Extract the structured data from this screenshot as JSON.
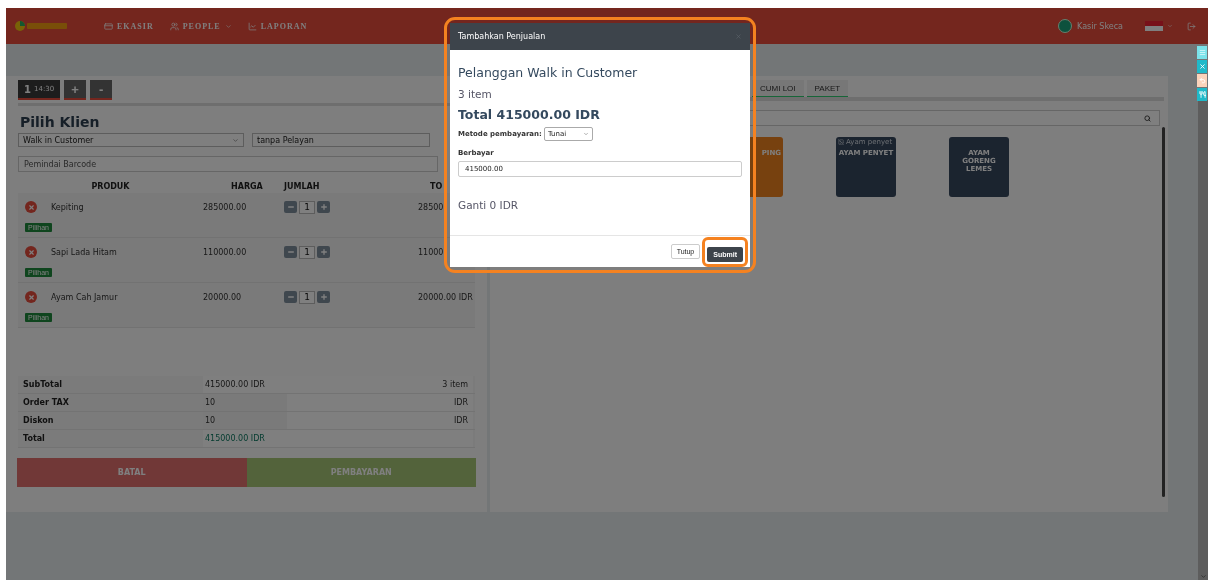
{
  "navbar": {
    "menu": [
      {
        "label": "EKASIR",
        "dropdown": false
      },
      {
        "label": "PEOPLE",
        "dropdown": true
      },
      {
        "label": "LAPORAN",
        "dropdown": false
      }
    ],
    "user": "Kasir Skeca"
  },
  "order_tab": {
    "number": "1",
    "time": "14:30",
    "selected": true
  },
  "order_actions": [
    "+",
    "-"
  ],
  "client": {
    "title": "Pilih Klien",
    "customer": "Walk in Customer",
    "waiter": "tanpa Pelayan",
    "barcode_placeholder": "Pemindai Barcode"
  },
  "cart": {
    "columns": [
      "PRODUK",
      "HARGA",
      "JUMLAH",
      "TO"
    ],
    "rows": [
      {
        "product": "Kepiting",
        "price": "285000.00",
        "qty": "1",
        "total": "28500",
        "option": "Pilihan"
      },
      {
        "product": "Sapi Lada Hitam",
        "price": "110000.00",
        "qty": "1",
        "total": "11000",
        "option": "Pilihan"
      },
      {
        "product": "Ayam Cah Jamur",
        "price": "20000.00",
        "qty": "1",
        "total": "20000.00 IDR",
        "option": "Pilihan"
      }
    ]
  },
  "summary": [
    {
      "kind": "text",
      "label": "SubTotal",
      "value": "415000.00 IDR",
      "unit": "3 item"
    },
    {
      "kind": "input",
      "label": "Order TAX",
      "value": "10",
      "unit": "IDR"
    },
    {
      "kind": "input",
      "label": "Diskon",
      "value": "10",
      "unit": "IDR"
    },
    {
      "kind": "total",
      "label": "Total",
      "value": "415000.00 IDR"
    }
  ],
  "actions": {
    "cancel": "BATAL",
    "pay": "PEMBAYARAN"
  },
  "categories": [
    "CUMI LOI",
    "PAKET"
  ],
  "products": [
    {
      "name": "PING",
      "kind": "highlighted"
    },
    {
      "name": "AYAM PENYET",
      "kind": "plain",
      "image_alt": "Ayam penyet"
    },
    {
      "name": "AYAM GORENG LEMES",
      "kind": "plain"
    }
  ],
  "modal": {
    "title": "Tambahkan Penjualan",
    "customer": "Pelanggan Walk in Customer",
    "items": "3 item",
    "total": "Total 415000.00 IDR",
    "method_label": "Metode pembayaran:",
    "method": "Tunai",
    "paid_label": "Berbayar",
    "paid": "415000.00",
    "change": "Ganti 0 IDR",
    "close": "Tutup",
    "submit": "Submit"
  }
}
